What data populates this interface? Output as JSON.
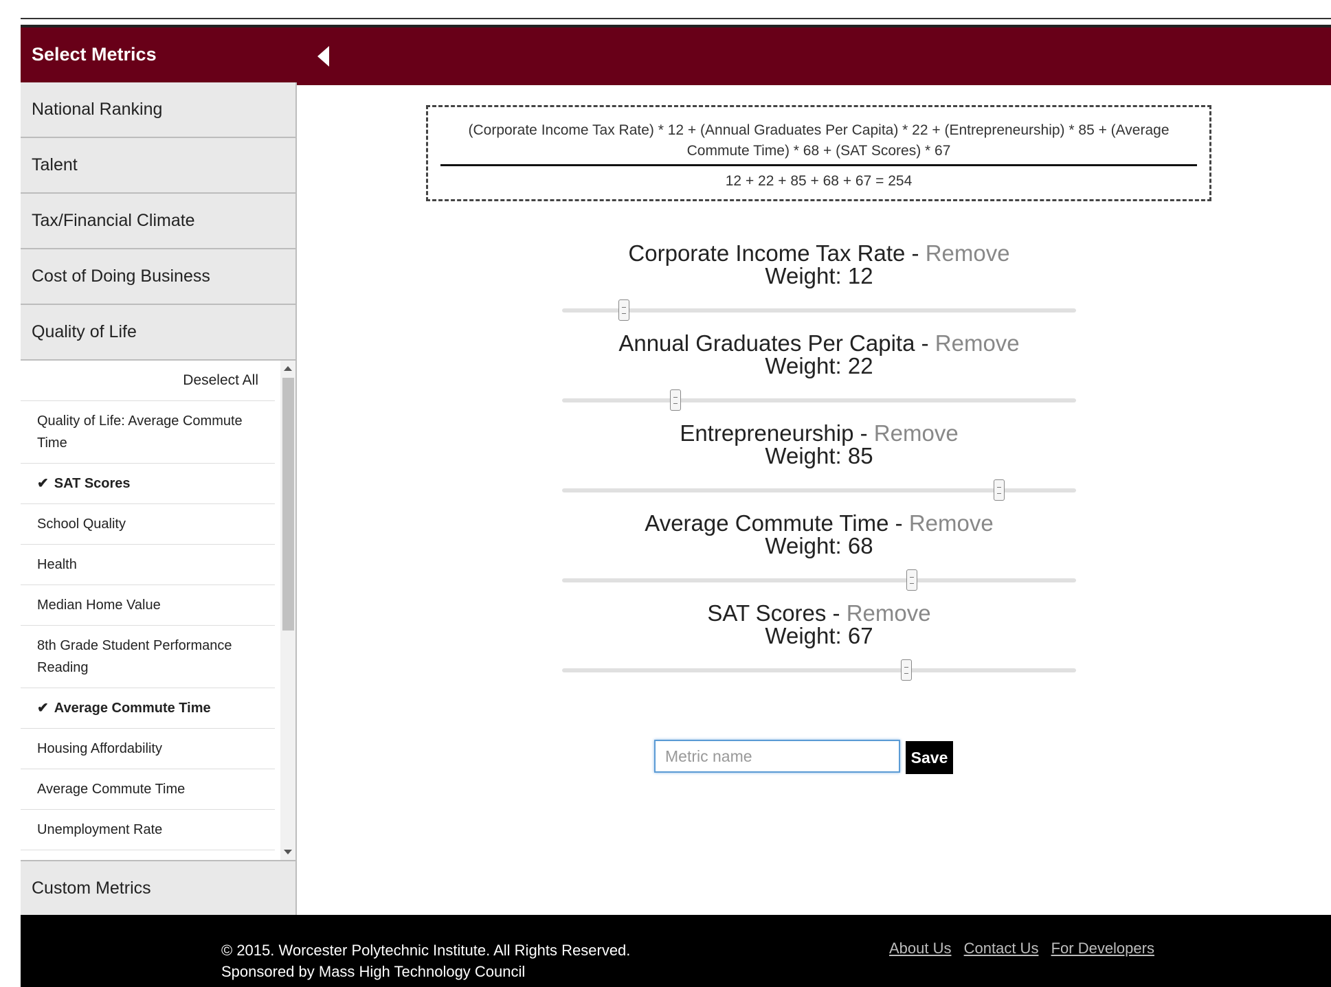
{
  "header": {
    "title": "Select Metrics",
    "collapse_icon": "caret-left-icon"
  },
  "sidebar": {
    "categories": [
      "National Ranking",
      "Talent",
      "Tax/Financial Climate",
      "Cost of Doing Business",
      "Quality of Life"
    ],
    "deselect_all": "Deselect All",
    "subitems": [
      {
        "label": "Quality of Life: Average Commute Time",
        "selected": false
      },
      {
        "label": "SAT Scores",
        "selected": true
      },
      {
        "label": "School Quality",
        "selected": false
      },
      {
        "label": "Health",
        "selected": false
      },
      {
        "label": "Median Home Value",
        "selected": false
      },
      {
        "label": "8th Grade Student Performance Reading",
        "selected": false
      },
      {
        "label": "Average Commute Time",
        "selected": true
      },
      {
        "label": "Housing Affordability",
        "selected": false
      },
      {
        "label": "Average Commute Time",
        "selected": false
      },
      {
        "label": "Unemployment Rate",
        "selected": false
      }
    ],
    "check_mark": "✔",
    "custom": "Custom Metrics"
  },
  "formula": {
    "numerator": "(Corporate Income Tax Rate) * 12 + (Annual Graduates Per Capita) * 22 + (Entrepreneurship) * 85 + (Average Commute Time) * 68 + (SAT Scores) * 67",
    "denominator": "12 + 22 + 85 + 68 + 67 = 254"
  },
  "metrics": [
    {
      "name": "Corporate Income Tax Rate",
      "remove": "Remove",
      "weight_label": "Weight: 12",
      "weight": 12
    },
    {
      "name": "Annual Graduates Per Capita",
      "remove": "Remove",
      "weight_label": "Weight: 22",
      "weight": 22
    },
    {
      "name": "Entrepreneurship",
      "remove": "Remove",
      "weight_label": "Weight: 85",
      "weight": 85
    },
    {
      "name": "Average Commute Time",
      "remove": "Remove",
      "weight_label": "Weight: 68",
      "weight": 68
    },
    {
      "name": "SAT Scores",
      "remove": "Remove",
      "weight_label": "Weight: 67",
      "weight": 67
    }
  ],
  "save_form": {
    "placeholder": "Metric name",
    "value": "",
    "save_label": "Save"
  },
  "footer": {
    "copyright": "© 2015. Worcester Polytechnic Institute. All Rights Reserved.",
    "sponsor": "Sponsored by Mass High Technology Council",
    "links": [
      "About Us",
      "Contact Us",
      "For Developers"
    ]
  }
}
